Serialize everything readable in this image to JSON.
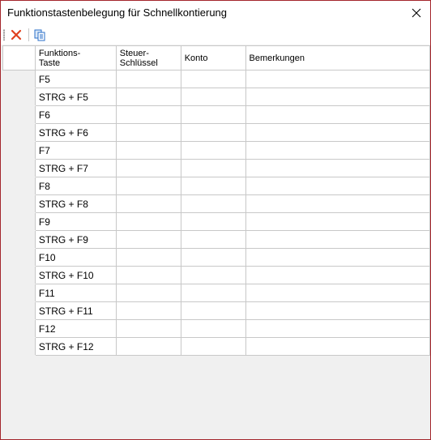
{
  "window": {
    "title": "Funktionstastenbelegung für Schnellkontierung",
    "close_icon": "close-icon"
  },
  "toolbar": {
    "delete_icon": "delete-x-icon",
    "copy_icon": "copy-icon",
    "colors": {
      "delete": "#e0401e",
      "copy": "#2a6fc9"
    }
  },
  "grid": {
    "columns": [
      "Funktions-\nTaste",
      "Steuer-\nSchlüssel",
      "Konto",
      "Bemerkungen"
    ],
    "rows": [
      {
        "key": "F5",
        "steuer": "",
        "konto": "",
        "bemerkungen": ""
      },
      {
        "key": "STRG + F5",
        "steuer": "",
        "konto": "",
        "bemerkungen": ""
      },
      {
        "key": "F6",
        "steuer": "",
        "konto": "",
        "bemerkungen": ""
      },
      {
        "key": "STRG + F6",
        "steuer": "",
        "konto": "",
        "bemerkungen": ""
      },
      {
        "key": "F7",
        "steuer": "",
        "konto": "",
        "bemerkungen": ""
      },
      {
        "key": "STRG + F7",
        "steuer": "",
        "konto": "",
        "bemerkungen": ""
      },
      {
        "key": "F8",
        "steuer": "",
        "konto": "",
        "bemerkungen": ""
      },
      {
        "key": "STRG + F8",
        "steuer": "",
        "konto": "",
        "bemerkungen": ""
      },
      {
        "key": "F9",
        "steuer": "",
        "konto": "",
        "bemerkungen": ""
      },
      {
        "key": "STRG + F9",
        "steuer": "",
        "konto": "",
        "bemerkungen": ""
      },
      {
        "key": "F10",
        "steuer": "",
        "konto": "",
        "bemerkungen": ""
      },
      {
        "key": "STRG + F10",
        "steuer": "",
        "konto": "",
        "bemerkungen": ""
      },
      {
        "key": "F11",
        "steuer": "",
        "konto": "",
        "bemerkungen": ""
      },
      {
        "key": "STRG + F11",
        "steuer": "",
        "konto": "",
        "bemerkungen": ""
      },
      {
        "key": "F12",
        "steuer": "",
        "konto": "",
        "bemerkungen": ""
      },
      {
        "key": "STRG + F12",
        "steuer": "",
        "konto": "",
        "bemerkungen": ""
      }
    ]
  },
  "colors": {
    "window_border": "#a4262c",
    "grid_line": "#c8c8c8",
    "background": "#f0f0f0"
  }
}
